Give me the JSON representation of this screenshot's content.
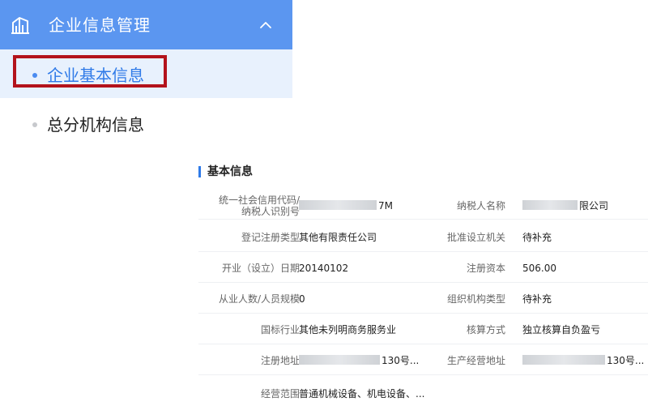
{
  "menu": {
    "header_title": "企业信息管理",
    "icon": "building-icon",
    "chevron": "chevron-up-icon",
    "items": [
      {
        "label": "企业基本信息",
        "active": true
      },
      {
        "label": "总分机构信息",
        "active": false
      }
    ]
  },
  "section": {
    "title": "基本信息"
  },
  "fields": {
    "credit_code": {
      "label_line1": "统一社会信用代码/",
      "label_line2": "纳税人识别号",
      "value_suffix": "7M"
    },
    "taxpayer_name": {
      "label": "纳税人名称",
      "value_suffix": "限公司"
    },
    "reg_type": {
      "label": "登记注册类型",
      "value": "其他有限责任公司"
    },
    "approval_org": {
      "label": "批准设立机关",
      "value": "待补充"
    },
    "open_date": {
      "label": "开业（设立）日期",
      "value": "20140102"
    },
    "reg_capital": {
      "label": "注册资本",
      "value": "506.00"
    },
    "staff": {
      "label": "从业人数/人员规模",
      "value": "0"
    },
    "org_type": {
      "label": "组织机构类型",
      "value": "待补充"
    },
    "industry": {
      "label": "国标行业",
      "value": "其他未列明商务服务业"
    },
    "accounting": {
      "label": "核算方式",
      "value": "独立核算自负盈亏"
    },
    "reg_address": {
      "label": "注册地址",
      "value_suffix": "130号..."
    },
    "biz_address": {
      "label": "生产经营地址",
      "value_suffix": "130号..."
    },
    "scope": {
      "label": "经营范围",
      "value": "普通机械设备、机电设备、..."
    }
  },
  "colors": {
    "header_bg": "#5b96f0",
    "active_bg": "#e8f1fd",
    "accent": "#2f7ae8",
    "highlight_border": "#b3131b"
  }
}
